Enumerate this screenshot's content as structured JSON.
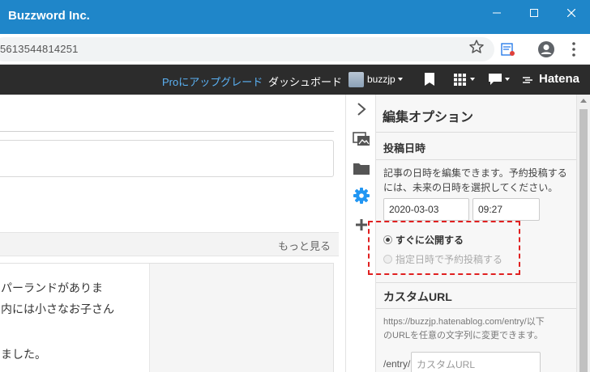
{
  "window": {
    "title": "Buzzword Inc."
  },
  "address": {
    "url": "5613544814251"
  },
  "nav": {
    "pro_link": "Proにアップグレード",
    "dashboard": "ダッシュボード",
    "username": "buzzjp",
    "brand": "Hatena"
  },
  "editor": {
    "more": "もっと見る",
    "lines": [
      "パーランドがありま",
      "内には小さなお子さん",
      "ました。"
    ]
  },
  "strip": {
    "icons": [
      "chevron-right-icon",
      "image-icon",
      "folder-icon",
      "gear-icon",
      "plus-icon"
    ]
  },
  "panel": {
    "title": "編集オプション",
    "date_section": "投稿日時",
    "date_desc_1": "記事の日時を編集できます。予約投稿する",
    "date_desc_2": "には、未来の日時を選択してください。",
    "date_value": "2020-03-03",
    "time_value": "09:27",
    "radio_now": "すぐに公開する",
    "radio_scheduled": "指定日時で予約投稿する",
    "custom_url_section": "カスタムURL",
    "url_desc_1": "https://buzzjp.hatenablog.com/entry/以下",
    "url_desc_2": "のURLを任意の文字列に変更できます。",
    "url_prefix": "/entry/",
    "url_placeholder": "カスタムURL"
  },
  "colors": {
    "titlebar": "#1f86c9",
    "navbar": "#2c2c2c",
    "pro_link": "#5bb2f5",
    "highlight": "#e02020",
    "gear": "#2196f3"
  }
}
